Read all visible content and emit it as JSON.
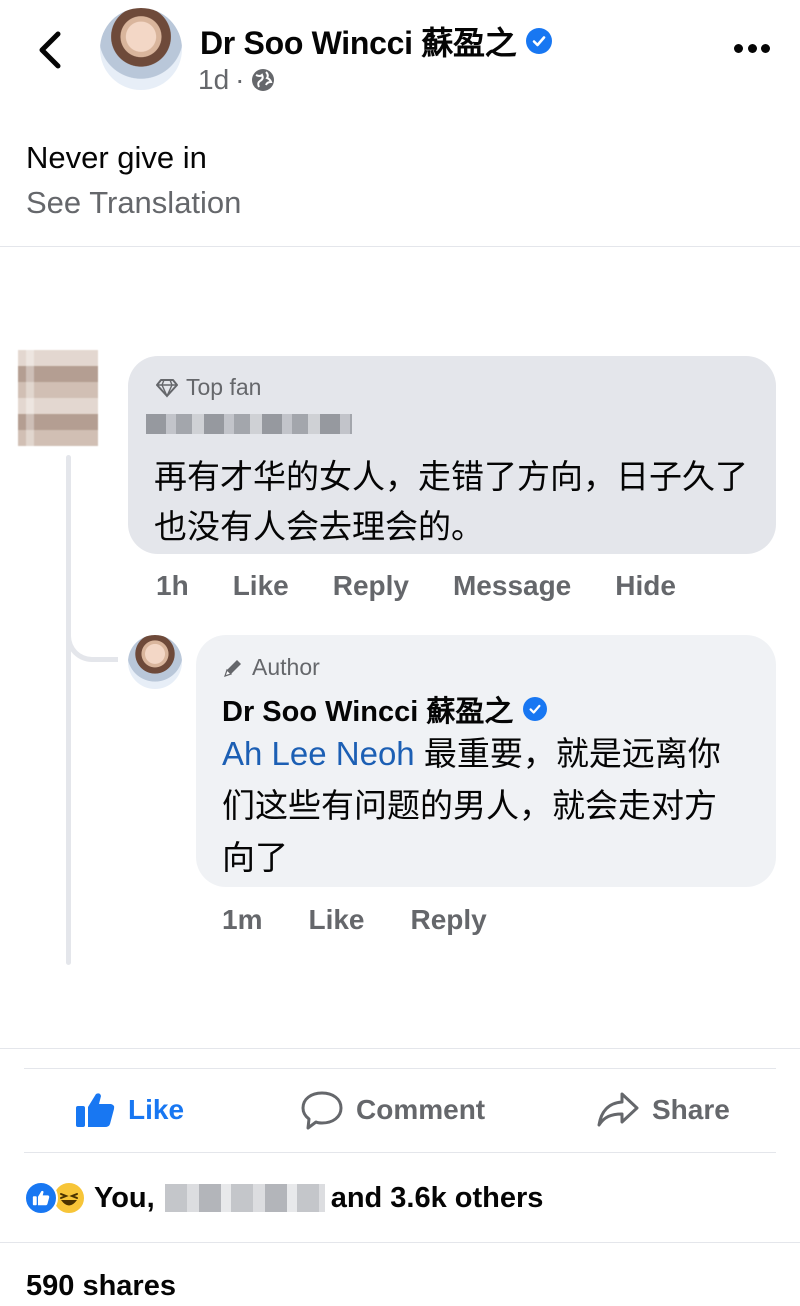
{
  "header": {
    "page_name": "Dr Soo Wincci 蘇盈之",
    "timestamp": "1d",
    "meta_separator": "·",
    "privacy_icon": "globe-icon"
  },
  "post": {
    "text": "Never give in",
    "see_translation": "See Translation"
  },
  "comments": [
    {
      "badge": "Top fan",
      "badge_icon": "diamond-icon",
      "text": "再有才华的女人，走错了方向，日子久了也没有人会去理会的。",
      "time": "1h",
      "actions": [
        "Like",
        "Reply",
        "Message",
        "Hide"
      ]
    }
  ],
  "reply": {
    "badge": "Author",
    "badge_icon": "pen-icon",
    "author": "Dr Soo Wincci 蘇盈之",
    "mention": "Ah Lee Neoh",
    "text": " 最重要，就是远离你们这些有问题的男人，就会走对方向了",
    "time": "1m",
    "actions": [
      "Like",
      "Reply"
    ]
  },
  "footer": {
    "like_label": "Like",
    "comment_label": "Comment",
    "share_label": "Share",
    "reactions_prefix": "You,",
    "reactions_suffix": "and 3.6k others",
    "shares": "590 shares"
  },
  "colors": {
    "facebook_blue": "#1877f2",
    "secondary_text": "#65676b",
    "bubble_gray": "#e4e6eb",
    "mention_blue": "#1c5fb4"
  }
}
